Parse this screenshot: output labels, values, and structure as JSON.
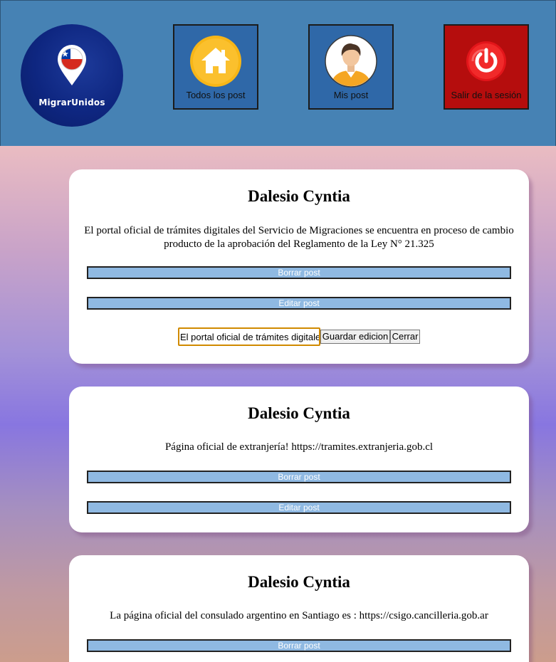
{
  "header": {
    "logo_text": "MigrarUnidos",
    "nav": [
      {
        "label": "Todos los post",
        "icon": "home-icon"
      },
      {
        "label": "Mis post",
        "icon": "user-avatar-icon"
      },
      {
        "label": "Salir de la sesión",
        "icon": "power-icon"
      }
    ]
  },
  "colors": {
    "header_bg": "#4682b4",
    "nav_button_bg": "#2f68a8",
    "logout_bg": "#b50d0d",
    "action_bar_bg": "#8fb9e2",
    "card_bg": "#ffffff"
  },
  "posts": [
    {
      "author": "Dalesio Cyntia",
      "text": "El portal oficial de trámites digitales del Servicio de Migraciones se encuentra en proceso de cambio producto de la aprobación del Reglamento de la Ley N° 21.325",
      "delete_label": "Borrar post",
      "edit_label": "Editar post",
      "edit_form": {
        "input_value": "El portal oficial de trámites digitales del Servicio de Migraciones se encuentra en proceso de cambio producto de la aprobación del Reglamento de la Ley N° 21.325",
        "save_label": "Guardar edicion",
        "close_label": "Cerrar"
      }
    },
    {
      "author": "Dalesio Cyntia",
      "text": "Página oficial de extranjería! https://tramites.extranjeria.gob.cl",
      "delete_label": "Borrar post",
      "edit_label": "Editar post"
    },
    {
      "author": "Dalesio Cyntia",
      "text": "La página oficial del consulado argentino en Santiago es : https://csigo.cancilleria.gob.ar",
      "delete_label": "Borrar post"
    }
  ]
}
